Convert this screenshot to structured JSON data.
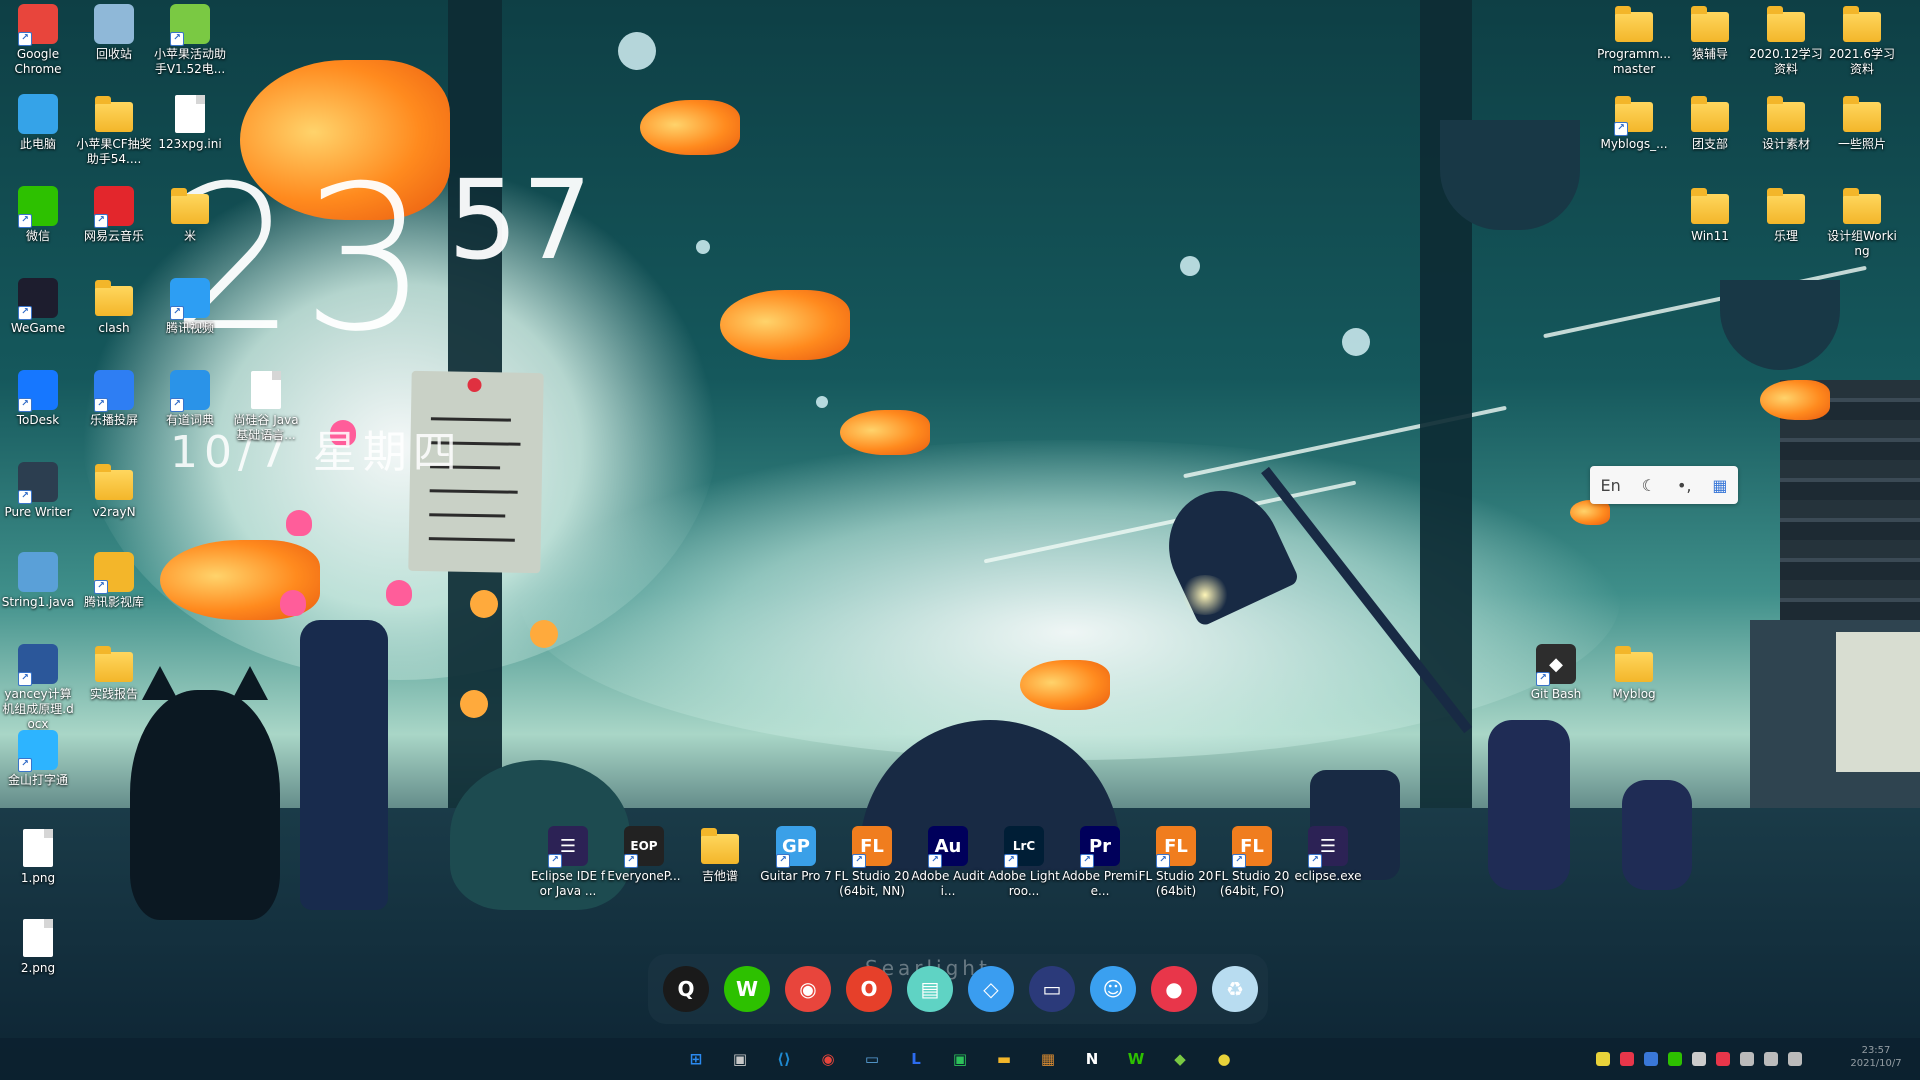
{
  "clock": {
    "hour": "23",
    "minute": "57",
    "date": "10/7 星期四"
  },
  "desktop_icons_left": [
    {
      "label": "Google\nChrome",
      "icon": "chrome-icon",
      "color": "#e8453c"
    },
    {
      "label": "回收站",
      "icon": "recycle-bin-icon",
      "color": "#8fb8d8"
    },
    {
      "label": "小苹果活动助手V1.52电...",
      "icon": "apple-icon",
      "color": "#7ac943"
    },
    {
      "label": "此电脑",
      "icon": "this-pc-icon",
      "color": "#35a3e8"
    },
    {
      "label": "小苹果CF抽奖助手54....",
      "icon": "folder-icon",
      "color": "#f3b62a"
    },
    {
      "label": "123xpg.ini",
      "icon": "ini-file-icon",
      "color": "#dddddd"
    },
    {
      "label": "微信",
      "icon": "wechat-icon",
      "color": "#2dc100"
    },
    {
      "label": "网易云音乐",
      "icon": "netease-music-icon",
      "color": "#e3262c"
    },
    {
      "label": "米",
      "icon": "folder-icon",
      "color": "#f3b62a"
    },
    {
      "label": "WeGame",
      "icon": "wegame-icon",
      "color": "#1d1d2e"
    },
    {
      "label": "clash",
      "icon": "folder-icon",
      "color": "#f3b62a"
    },
    {
      "label": "腾讯视频",
      "icon": "tencent-video-icon",
      "color": "#2d9ef3"
    },
    {
      "label": "ToDesk",
      "icon": "todesk-icon",
      "color": "#1677ff"
    },
    {
      "label": "乐播投屏",
      "icon": "lebo-cast-icon",
      "color": "#2e7ef3"
    },
    {
      "label": "有道词典",
      "icon": "youdao-icon",
      "color": "#2a93e8"
    },
    {
      "label": "尚硅谷 Java 基础语言...",
      "icon": "document-icon",
      "color": "#ffffff"
    },
    {
      "label": "Pure Writer",
      "icon": "pure-writer-icon",
      "color": "#2c3e50"
    },
    {
      "label": "v2rayN",
      "icon": "folder-icon",
      "color": "#f3b62a"
    },
    {
      "label": "String1.java",
      "icon": "java-file-icon",
      "color": "#5aa0d8"
    },
    {
      "label": "腾讯影视库",
      "icon": "tencent-video-library-icon",
      "color": "#f3b62a"
    },
    {
      "label": "yancey计算机组成原理.docx",
      "icon": "word-doc-icon",
      "color": "#2b579a"
    },
    {
      "label": "实践报告",
      "icon": "folder-icon",
      "color": "#f3b62a"
    },
    {
      "label": "金山打字通",
      "icon": "kingsoft-typing-icon",
      "color": "#2db4ff"
    },
    {
      "label": "1.png",
      "icon": "image-file-icon",
      "color": "#ffffff"
    },
    {
      "label": "2.png",
      "icon": "image-file-icon",
      "color": "#ffffff"
    }
  ],
  "desktop_icons_right": [
    {
      "label": "Programm... master",
      "icon": "folder-icon"
    },
    {
      "label": "猿辅导",
      "icon": "folder-icon"
    },
    {
      "label": "2020.12学习资料",
      "icon": "folder-icon"
    },
    {
      "label": "2021.6学习资料",
      "icon": "folder-icon"
    },
    {
      "label": "Myblogs_...",
      "icon": "folder-icon"
    },
    {
      "label": "团支部",
      "icon": "folder-icon"
    },
    {
      "label": "设计素材",
      "icon": "folder-icon"
    },
    {
      "label": "一些照片",
      "icon": "folder-icon"
    },
    {
      "label": "Win11",
      "icon": "folder-icon"
    },
    {
      "label": "乐理",
      "icon": "folder-icon"
    },
    {
      "label": "设计组Working",
      "icon": "folder-icon"
    },
    {
      "label": "Git Bash",
      "icon": "git-bash-icon"
    },
    {
      "label": "Myblog",
      "icon": "folder-icon"
    }
  ],
  "desktop_icons_bottom": [
    {
      "label": "Eclipse IDE for Java ...",
      "icon": "eclipse-icon",
      "color": "#2c2255",
      "glyph": "☰"
    },
    {
      "label": "EveryoneP...",
      "icon": "everyone-piano-icon",
      "color": "#222222",
      "glyph": "EOP"
    },
    {
      "label": "吉他谱",
      "icon": "folder-icon",
      "color": "#f3b62a",
      "glyph": ""
    },
    {
      "label": "Guitar Pro 7",
      "icon": "guitar-pro-icon",
      "color": "#3aa0e8",
      "glyph": "GP"
    },
    {
      "label": "FL Studio 20 (64bit, NN)",
      "icon": "fl-studio-icon",
      "color": "#f07d1e",
      "glyph": "FL"
    },
    {
      "label": "Adobe Auditi...",
      "icon": "adobe-audition-icon",
      "color": "#00005b",
      "glyph": "Au"
    },
    {
      "label": "Adobe Lightroo...",
      "icon": "adobe-lightroom-icon",
      "color": "#001e36",
      "glyph": "LrC"
    },
    {
      "label": "Adobe Premie...",
      "icon": "adobe-premiere-icon",
      "color": "#00005b",
      "glyph": "Pr"
    },
    {
      "label": "FL Studio 20 (64bit)",
      "icon": "fl-studio-icon",
      "color": "#f07d1e",
      "glyph": "FL"
    },
    {
      "label": "FL Studio 20 (64bit, FO)",
      "icon": "fl-studio-icon",
      "color": "#f07d1e",
      "glyph": "FL"
    },
    {
      "label": "eclipse.exe",
      "icon": "eclipse-icon",
      "color": "#2c2255",
      "glyph": "☰"
    }
  ],
  "langbar": {
    "lang": "En",
    "moon": "☾",
    "punct": "•,",
    "grid": "▦"
  },
  "dock": {
    "search_text": "Searlight",
    "items": [
      {
        "name": "qq-icon",
        "color": "#1a1a1a",
        "glyph": "Q"
      },
      {
        "name": "wechat-icon",
        "color": "#2dc100",
        "glyph": "W"
      },
      {
        "name": "chrome-icon",
        "color": "#e8453c",
        "glyph": "◉"
      },
      {
        "name": "office-icon",
        "color": "#e6402a",
        "glyph": "O"
      },
      {
        "name": "notes-icon",
        "color": "#5fd3c4",
        "glyph": "▤"
      },
      {
        "name": "store-icon",
        "color": "#3a9df0",
        "glyph": "◇"
      },
      {
        "name": "files-icon",
        "color": "#2b3a7a",
        "glyph": "▭"
      },
      {
        "name": "finder-icon",
        "color": "#3aa0f0",
        "glyph": "☺"
      },
      {
        "name": "screenshot-icon",
        "color": "#e8364a",
        "glyph": "●"
      },
      {
        "name": "recycle-bin-icon",
        "color": "#b8dcf0",
        "glyph": "♻"
      }
    ]
  },
  "taskbar": {
    "items": [
      {
        "name": "start-icon",
        "color": "#2b8af0",
        "glyph": "⊞"
      },
      {
        "name": "task-view-icon",
        "color": "#c8c8c8",
        "glyph": "▣"
      },
      {
        "name": "vscode-icon",
        "color": "#1f8ad2",
        "glyph": "⟨⟩"
      },
      {
        "name": "chrome-icon",
        "color": "#e8453c",
        "glyph": "◉"
      },
      {
        "name": "remote-desktop-icon",
        "color": "#5aa0d8",
        "glyph": "▭"
      },
      {
        "name": "l-app-icon",
        "color": "#2d6cf0",
        "glyph": "L"
      },
      {
        "name": "green-app-icon",
        "color": "#2dc15a",
        "glyph": "▣"
      },
      {
        "name": "file-explorer-icon",
        "color": "#f3b62a",
        "glyph": "▬"
      },
      {
        "name": "tiger-app-icon",
        "color": "#d88a30",
        "glyph": "▦"
      },
      {
        "name": "notion-icon",
        "color": "#ffffff",
        "glyph": "N"
      },
      {
        "name": "wechat-icon",
        "color": "#2dc100",
        "glyph": "W"
      },
      {
        "name": "git-app-icon",
        "color": "#7ac943",
        "glyph": "◆"
      },
      {
        "name": "yellow-app-icon",
        "color": "#e8d23a",
        "glyph": "●"
      }
    ],
    "tray_colors": [
      "#e8d23a",
      "#e8364a",
      "#3a78d8",
      "#2dc100",
      "#cccccc",
      "#e8364a",
      "#bbbbbb",
      "#bbbbbb",
      "#bbbbbb"
    ],
    "clock_time": "23:57",
    "clock_date": "2021/10/7"
  }
}
